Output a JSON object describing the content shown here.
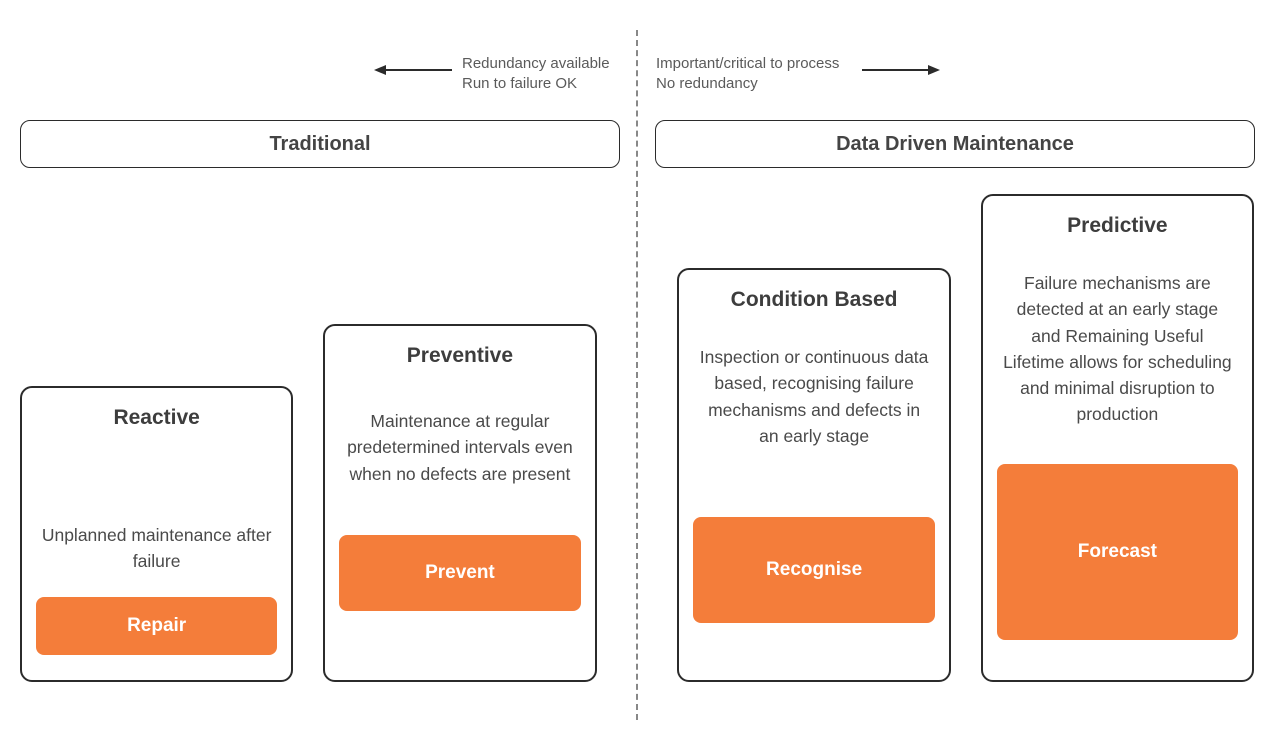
{
  "top_left": {
    "line1": "Redundancy available",
    "line2": "Run to failure OK"
  },
  "top_right": {
    "line1": "Important/critical to process",
    "line2": "No redundancy"
  },
  "sections": {
    "left_title": "Traditional",
    "right_title": "Data Driven Maintenance"
  },
  "cards": {
    "reactive": {
      "title": "Reactive",
      "desc": "Unplanned maintenance after failure",
      "action": "Repair"
    },
    "preventive": {
      "title": "Preventive",
      "desc": "Maintenance at regular predetermined intervals even when no defects are present",
      "action": "Prevent"
    },
    "condition": {
      "title": "Condition Based",
      "desc": "Inspection or continuous data based, recognising failure mechanisms and defects in an early stage",
      "action": "Recognise"
    },
    "predictive": {
      "title": "Predictive",
      "desc": "Failure mechanisms are detected at an early stage and Remaining Useful Lifetime allows for scheduling and minimal disruption to production",
      "action": "Forecast"
    }
  },
  "colors": {
    "accent": "#f47d3a"
  }
}
